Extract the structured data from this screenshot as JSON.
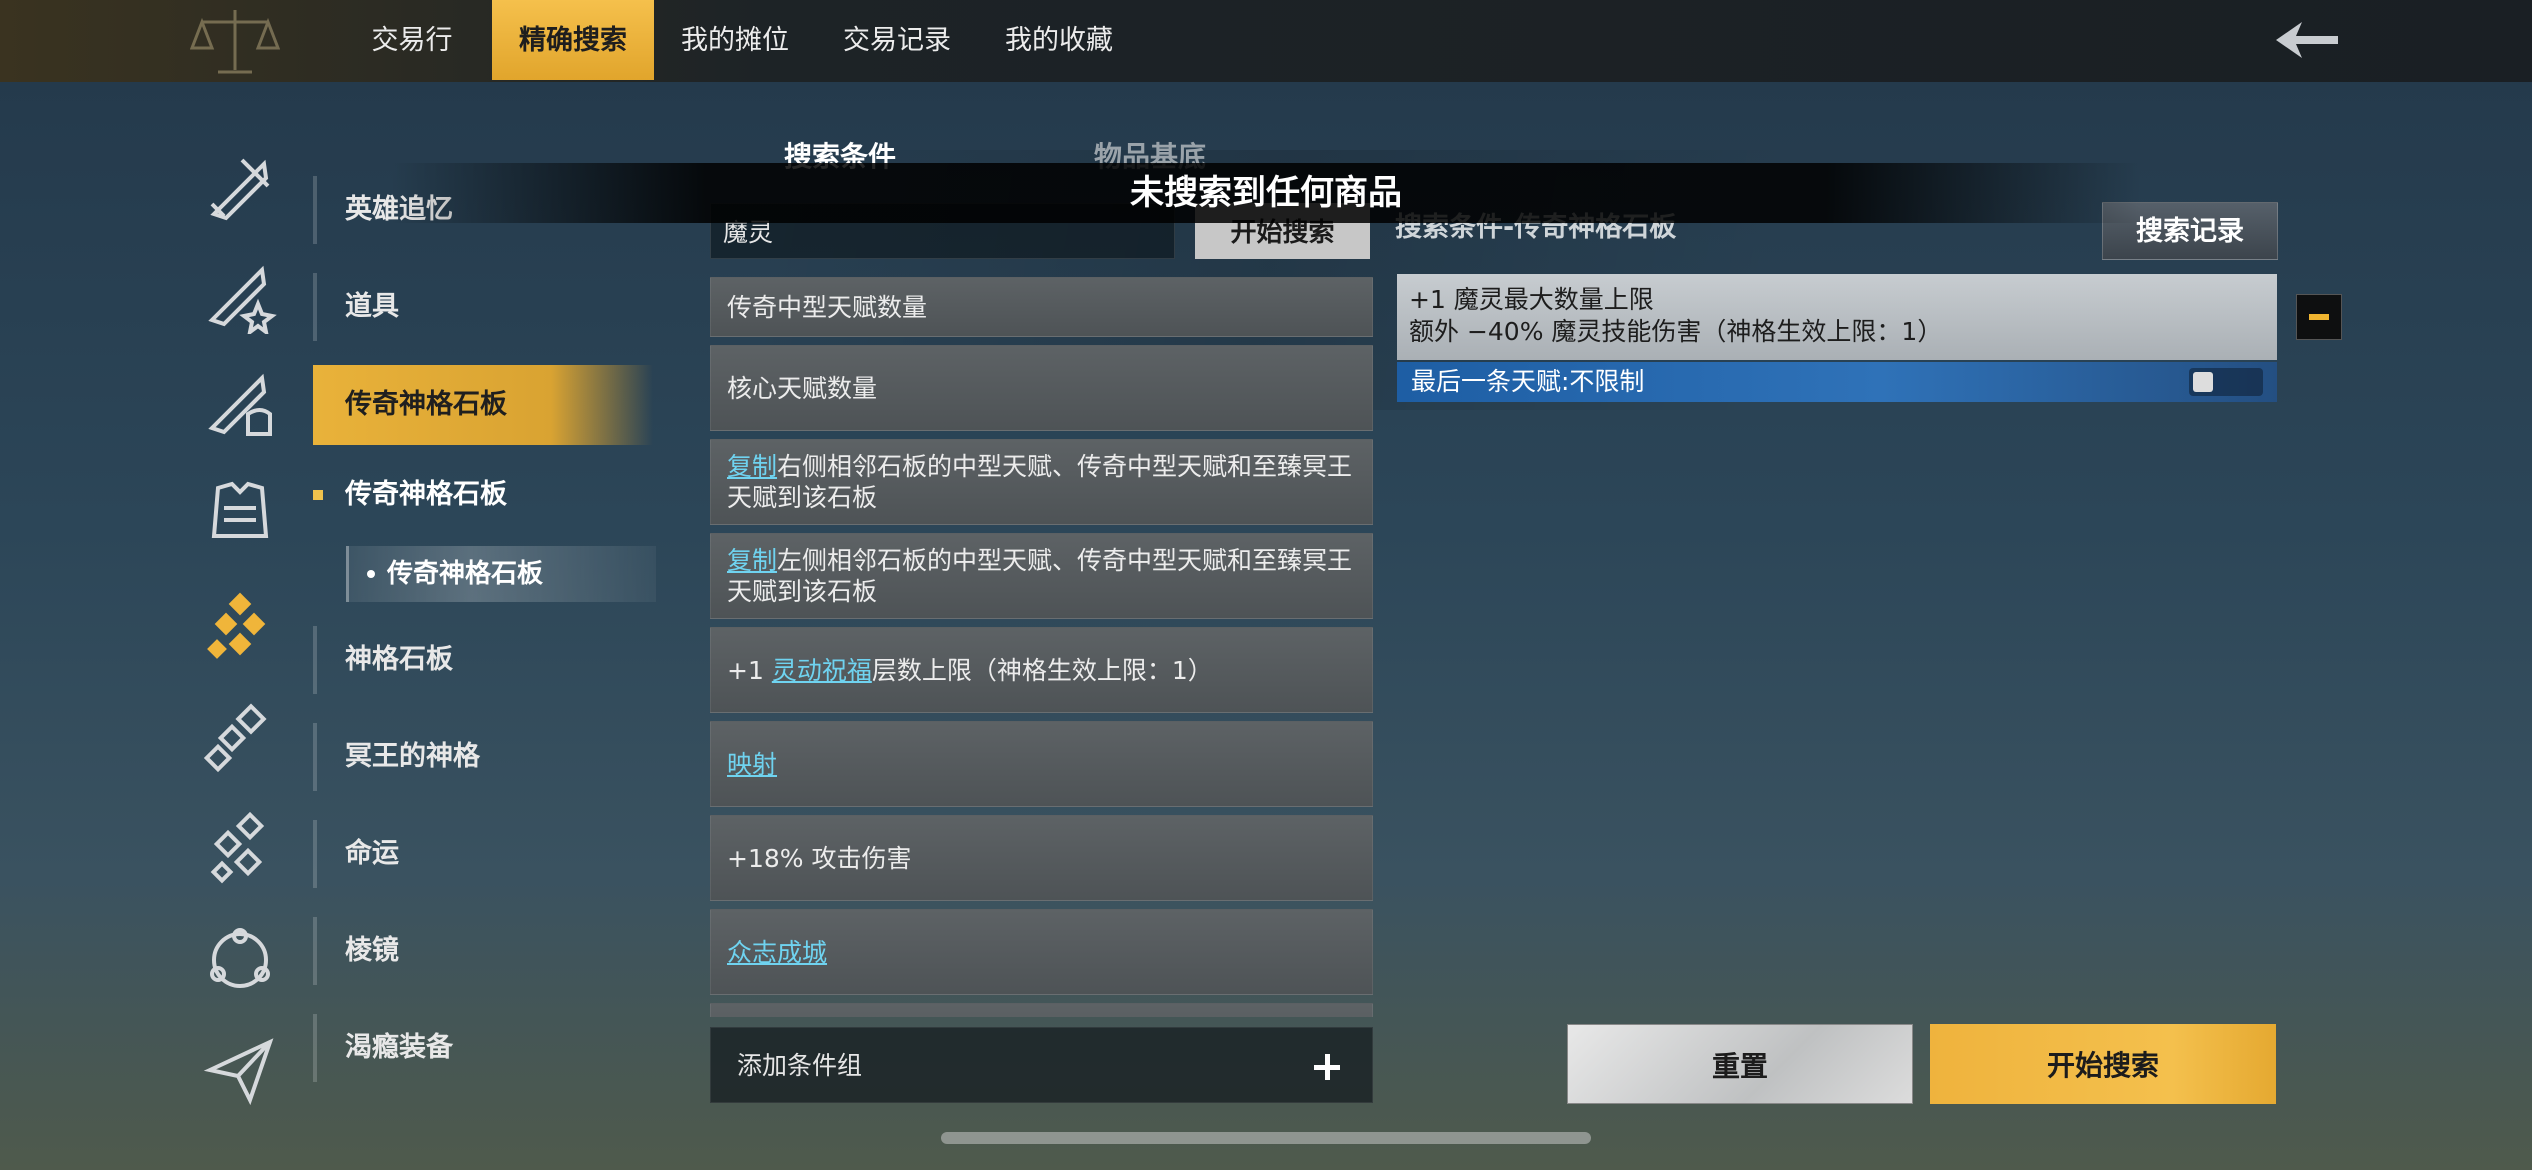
{
  "tabs": [
    {
      "label": "交易行",
      "active": false
    },
    {
      "label": "精确搜索",
      "active": true
    },
    {
      "label": "我的摊位",
      "active": false
    },
    {
      "label": "交易记录",
      "active": false
    },
    {
      "label": "我的收藏",
      "active": false
    }
  ],
  "categories": [
    {
      "label": "英雄追忆",
      "active": false
    },
    {
      "label": "道具",
      "active": false
    },
    {
      "label": "传奇神格石板",
      "active": true
    },
    {
      "label": "神格石板",
      "active": false
    },
    {
      "label": "冥王的神格",
      "active": false
    },
    {
      "label": "命运",
      "active": false
    },
    {
      "label": "棱镜",
      "active": false
    },
    {
      "label": "渴瘾装备",
      "active": false
    }
  ],
  "subcategory": "传奇神格石板",
  "subsubcategory": "传奇神格石板",
  "subtabs": {
    "conditions": "搜索条件",
    "base": "物品基底"
  },
  "search": {
    "value": "魔灵",
    "button": "开始搜索"
  },
  "conditions": [
    {
      "parts": [
        {
          "text": "传奇中型天赋数量",
          "link": false
        }
      ]
    },
    {
      "parts": [
        {
          "text": "核心天赋数量",
          "link": false
        }
      ]
    },
    {
      "parts": [
        {
          "text": "复制",
          "link": true
        },
        {
          "text": "右侧相邻石板的中型天赋、传奇中型天赋和至臻冥王天赋到该石板",
          "link": false
        }
      ]
    },
    {
      "parts": [
        {
          "text": "复制",
          "link": true
        },
        {
          "text": "左侧相邻石板的中型天赋、传奇中型天赋和至臻冥王天赋到该石板",
          "link": false
        }
      ]
    },
    {
      "parts": [
        {
          "text": "+1 ",
          "link": false
        },
        {
          "text": "灵动祝福",
          "link": true
        },
        {
          "text": "层数上限（神格生效上限：1）",
          "link": false
        }
      ]
    },
    {
      "parts": [
        {
          "text": "映射",
          "link": true
        }
      ]
    },
    {
      "parts": [
        {
          "text": "+18% 攻击伤害",
          "link": false
        }
      ]
    },
    {
      "parts": [
        {
          "text": "众志成城",
          "link": true
        }
      ]
    }
  ],
  "add_group": "添加条件组",
  "right": {
    "header": "搜索条件-传奇神格石板",
    "history_button": "搜索记录",
    "selected_line1": "+1 魔灵最大数量上限",
    "selected_line2": "额外 −40% 魔灵技能伤害（神格生效上限：1）",
    "last_talent": "最后一条天赋:不限制",
    "reset": "重置",
    "search": "开始搜索"
  },
  "toast": "未搜索到任何商品",
  "colors": {
    "accent": "#f0b53a",
    "link": "#6fd3f0",
    "highlight_blue": "#2f72b8"
  },
  "icons": [
    "scales-icon",
    "back-arrow-icon",
    "sword-icon",
    "sword-star-icon",
    "sword-helmet-icon",
    "armor-icon",
    "slate-icon",
    "slate-outline-icon",
    "slate-alt-icon",
    "prism-icon",
    "send-icon",
    "plus-icon",
    "minus-icon"
  ]
}
